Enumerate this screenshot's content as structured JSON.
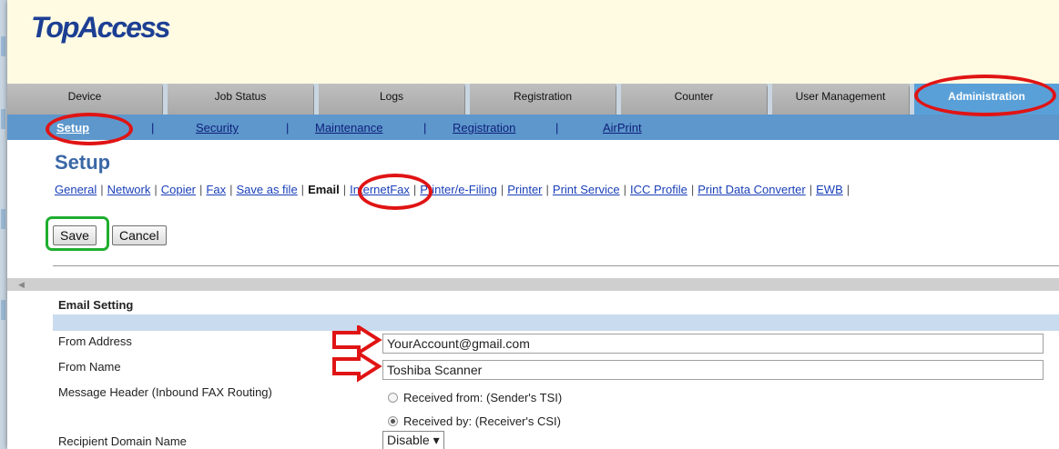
{
  "app": {
    "logo": "TopAccess"
  },
  "tabs": [
    {
      "label": "Device"
    },
    {
      "label": "Job Status"
    },
    {
      "label": "Logs"
    },
    {
      "label": "Registration"
    },
    {
      "label": "Counter"
    },
    {
      "label": "User Management"
    },
    {
      "label": "Administration",
      "active": true
    }
  ],
  "subnav": {
    "items": [
      "Setup",
      "Security",
      "Maintenance",
      "Registration",
      "AirPrint"
    ],
    "separator": "|",
    "active": "Setup"
  },
  "page": {
    "title": "Setup"
  },
  "categories": {
    "items": [
      "General",
      "Network",
      "Copier",
      "Fax",
      "Save as file",
      "Email",
      "InternetFax",
      "Printer/e-Filing",
      "Printer",
      "Print Service",
      "ICC Profile",
      "Print Data Converter",
      "EWB"
    ],
    "active": "Email"
  },
  "buttons": {
    "save": "Save",
    "cancel": "Cancel"
  },
  "email": {
    "section_title": "Email Setting",
    "from_address_label": "From Address",
    "from_address_value": "YourAccount@gmail.com",
    "from_name_label": "From Name",
    "from_name_value": "Toshiba Scanner",
    "message_header_label": "Message Header (Inbound FAX Routing)",
    "radio_options": [
      {
        "label": "Received from: (Sender's TSI)",
        "selected": false
      },
      {
        "label": "Received by: (Receiver's CSI)",
        "selected": true
      }
    ],
    "recipient_domain_label": "Recipient Domain Name",
    "recipient_domain_value": "Disable"
  },
  "colors": {
    "highlight": "#e01414",
    "save_highlight": "#1fae2f",
    "subnav_bg": "#5d97cc",
    "active_tab": "#5aa0d8",
    "title": "#3a68a6"
  }
}
